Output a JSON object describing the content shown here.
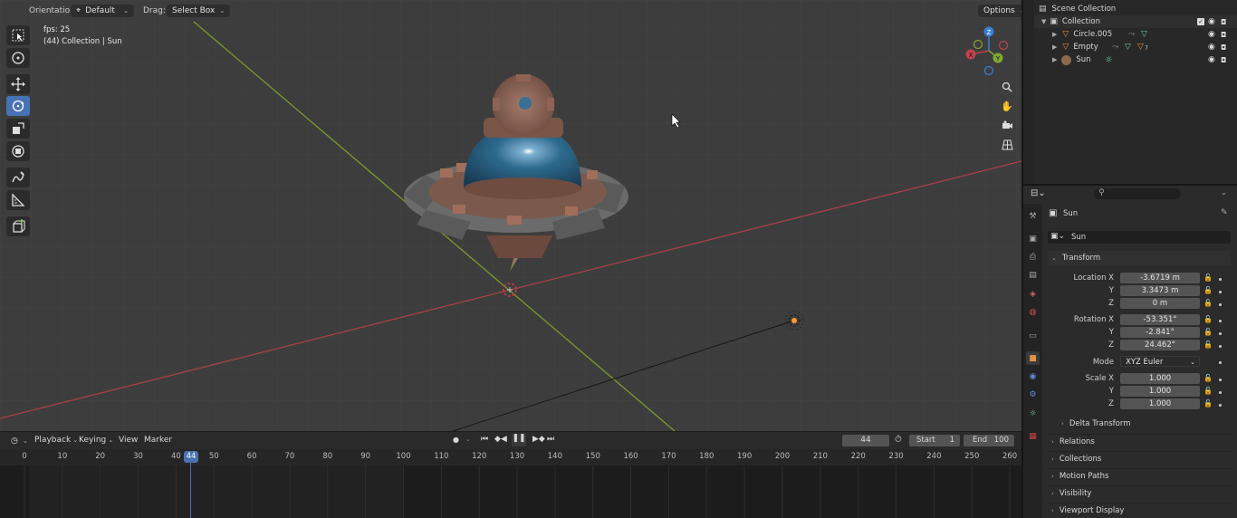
{
  "viewport_header": {
    "orientation_label": "Orientation:",
    "orientation_value": "Default",
    "drag_label": "Drag:",
    "drag_value": "Select Box",
    "options_label": "Options"
  },
  "overlay": {
    "fps": "fps: 25",
    "context": "(44) Collection | Sun"
  },
  "gizmo": {
    "z": "Z",
    "y": "Y",
    "x": "X"
  },
  "timeline": {
    "menus": [
      "Playback",
      "Keying",
      "View",
      "Marker"
    ],
    "current_frame": "44",
    "start_label": "Start",
    "start_value": "1",
    "end_label": "End",
    "end_value": "100",
    "ticks": [
      "0",
      "10",
      "20",
      "30",
      "40",
      "50",
      "60",
      "70",
      "80",
      "90",
      "100",
      "110",
      "120",
      "130",
      "140",
      "150",
      "160",
      "170",
      "180",
      "190",
      "200",
      "210",
      "220",
      "230",
      "240",
      "250",
      "260"
    ],
    "playhead": "44"
  },
  "outliner": {
    "scene_collection": "Scene Collection",
    "collection": "Collection",
    "items": [
      "Circle.005",
      "Empty",
      "Sun"
    ],
    "empty_badge": "7"
  },
  "properties": {
    "search_placeholder": "",
    "object_name": "Sun",
    "data_name": "Sun",
    "transform_label": "Transform",
    "location_x_label": "Location X",
    "location_x": "-3.6719 m",
    "y_label": "Y",
    "location_y": "3.3473 m",
    "z_label": "Z",
    "location_z": "0 m",
    "rotation_x_label": "Rotation X",
    "rotation_x": "-53.351°",
    "rotation_y": "-2.841°",
    "rotation_z": "24.462°",
    "mode_label": "Mode",
    "mode_value": "XYZ Euler",
    "scale_x_label": "Scale X",
    "scale_x": "1.000",
    "scale_y": "1.000",
    "scale_z": "1.000",
    "delta_transform": "Delta Transform",
    "relations": "Relations",
    "collections": "Collections",
    "motion_paths": "Motion Paths",
    "visibility": "Visibility",
    "viewport_display": "Viewport Display"
  },
  "colors": {
    "accent": "#4772b3",
    "x_axis": "#c0424e",
    "y_axis": "#80a833",
    "z_axis": "#3a7fd6"
  }
}
